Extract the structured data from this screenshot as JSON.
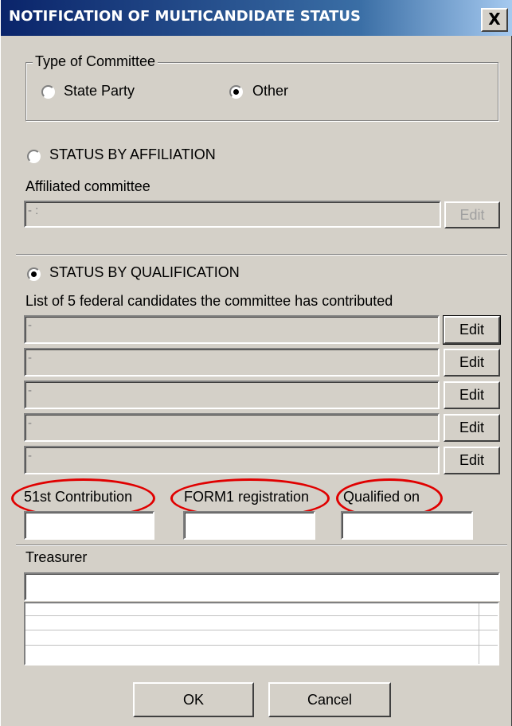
{
  "window": {
    "title": "NOTIFICATION OF MULTICANDIDATE STATUS",
    "close_label": "X"
  },
  "committee_type": {
    "legend": "Type of Committee",
    "options": [
      {
        "label": "State Party",
        "checked": false
      },
      {
        "label": "Other",
        "checked": true
      }
    ]
  },
  "affiliation": {
    "radio_label": "STATUS BY AFFILIATION",
    "checked": false,
    "field_label": "Affiliated committee",
    "field_value": "- :",
    "edit_label": "Edit"
  },
  "qualification": {
    "radio_label": "STATUS BY QUALIFICATION",
    "checked": true,
    "list_label": "List of 5 federal candidates the committee has contributed",
    "candidates": [
      {
        "value": "-",
        "edit_label": "Edit"
      },
      {
        "value": "-",
        "edit_label": "Edit"
      },
      {
        "value": "-",
        "edit_label": "Edit"
      },
      {
        "value": "-",
        "edit_label": "Edit"
      },
      {
        "value": "-",
        "edit_label": "Edit"
      }
    ],
    "dates": [
      {
        "label": "51st Contribution",
        "value": ""
      },
      {
        "label": "FORM1 registration",
        "value": ""
      },
      {
        "label": "Qualified on",
        "value": ""
      }
    ]
  },
  "treasurer": {
    "label": "Treasurer",
    "name_value": ""
  },
  "footer": {
    "ok_label": "OK",
    "cancel_label": "Cancel"
  },
  "colors": {
    "title_bar": "#0a246a",
    "dialog_bg": "#d4d0c8",
    "highlight_ellipse": "#e00000"
  }
}
